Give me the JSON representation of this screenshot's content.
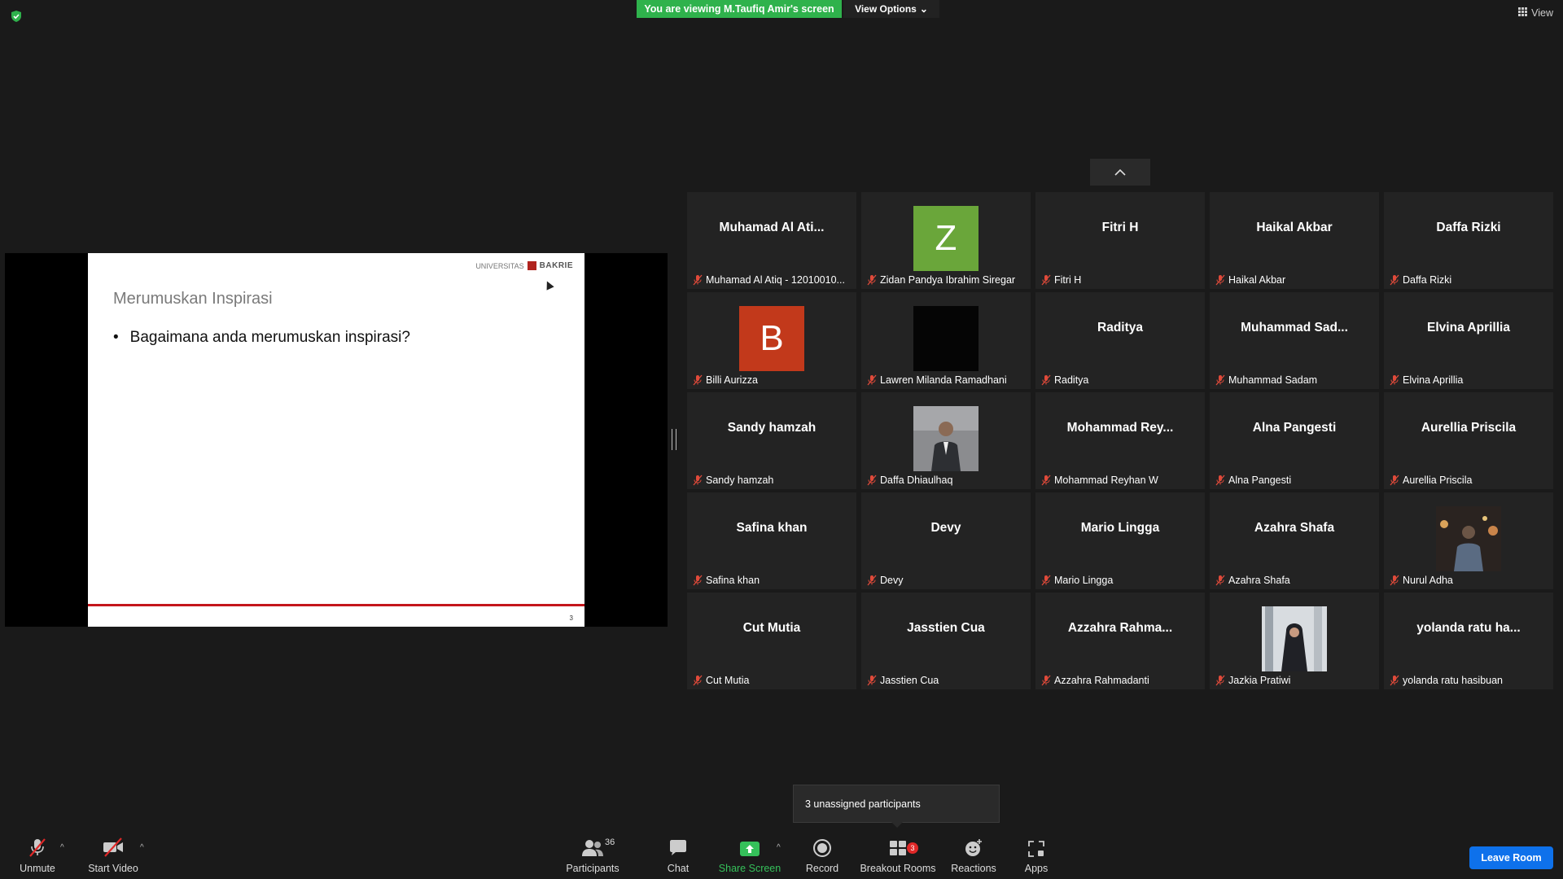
{
  "banner": {
    "text": "You are viewing M.Taufiq Amir's screen",
    "color": "#2fb24c"
  },
  "view_options": {
    "label": "View Options"
  },
  "view_button": {
    "label": "View"
  },
  "slide": {
    "logo_small": "UNIVERSITAS",
    "logo_brand": "BAKRIE",
    "title": "Merumuskan Inspirasi",
    "bullet": "Bagaimana anda merumuskan inspirasi?",
    "page": "3"
  },
  "tiles": [
    {
      "big": "Muhamad Al Ati...",
      "label": "Muhamad Al Atiq - 12010010..."
    },
    {
      "big": "",
      "avatar": "Z",
      "avatar_color": "#6aa63a",
      "label": "Zidan Pandya Ibrahim Siregar"
    },
    {
      "big": "Fitri H",
      "label": "Fitri H"
    },
    {
      "big": "Haikal Akbar",
      "label": "Haikal Akbar"
    },
    {
      "big": "Daffa Rizki",
      "label": "Daffa Rizki"
    },
    {
      "big": "",
      "avatar": "B",
      "avatar_color": "#c2391b",
      "label": "Billi Aurizza"
    },
    {
      "big": "",
      "photo": "black",
      "label": "Lawren Milanda Ramadhani"
    },
    {
      "big": "Raditya",
      "label": "Raditya"
    },
    {
      "big": "Muhammad  Sad...",
      "label": "Muhammad Sadam"
    },
    {
      "big": "Elvina Aprillia",
      "label": "Elvina Aprillia"
    },
    {
      "big": "Sandy hamzah",
      "label": "Sandy hamzah"
    },
    {
      "big": "",
      "photo": "man",
      "label": "Daffa Dhiaulhaq"
    },
    {
      "big": "Mohammad  Rey...",
      "label": "Mohammad Reyhan W"
    },
    {
      "big": "Alna Pangesti",
      "label": "Alna Pangesti"
    },
    {
      "big": "Aurellia Priscila",
      "label": "Aurellia Priscila"
    },
    {
      "big": "Safina khan",
      "label": "Safina khan"
    },
    {
      "big": "Devy",
      "label": "Devy"
    },
    {
      "big": "Mario Lingga",
      "label": "Mario Lingga"
    },
    {
      "big": "Azahra Shafa",
      "label": "Azahra Shafa"
    },
    {
      "big": "",
      "photo": "night",
      "label": "Nurul Adha"
    },
    {
      "big": "Cut Mutia",
      "label": "Cut Mutia"
    },
    {
      "big": "Jasstien Cua",
      "label": "Jasstien Cua"
    },
    {
      "big": "Azzahra  Rahma...",
      "label": "Azzahra Rahmadanti"
    },
    {
      "big": "",
      "photo": "hijab",
      "label": "Jazkia Pratiwi"
    },
    {
      "big": "yolanda ratu ha...",
      "label": "yolanda ratu hasibuan"
    }
  ],
  "tooltip": {
    "text": "3 unassigned participants"
  },
  "toolbar": {
    "unmute": "Unmute",
    "start_video": "Start Video",
    "participants": "Participants",
    "participants_count": "36",
    "chat": "Chat",
    "share_screen": "Share Screen",
    "record": "Record",
    "breakout_rooms": "Breakout Rooms",
    "breakout_badge": "3",
    "reactions": "Reactions",
    "apps": "Apps",
    "leave": "Leave Room",
    "leave_color": "#0e71eb",
    "share_color": "#35c05a"
  }
}
